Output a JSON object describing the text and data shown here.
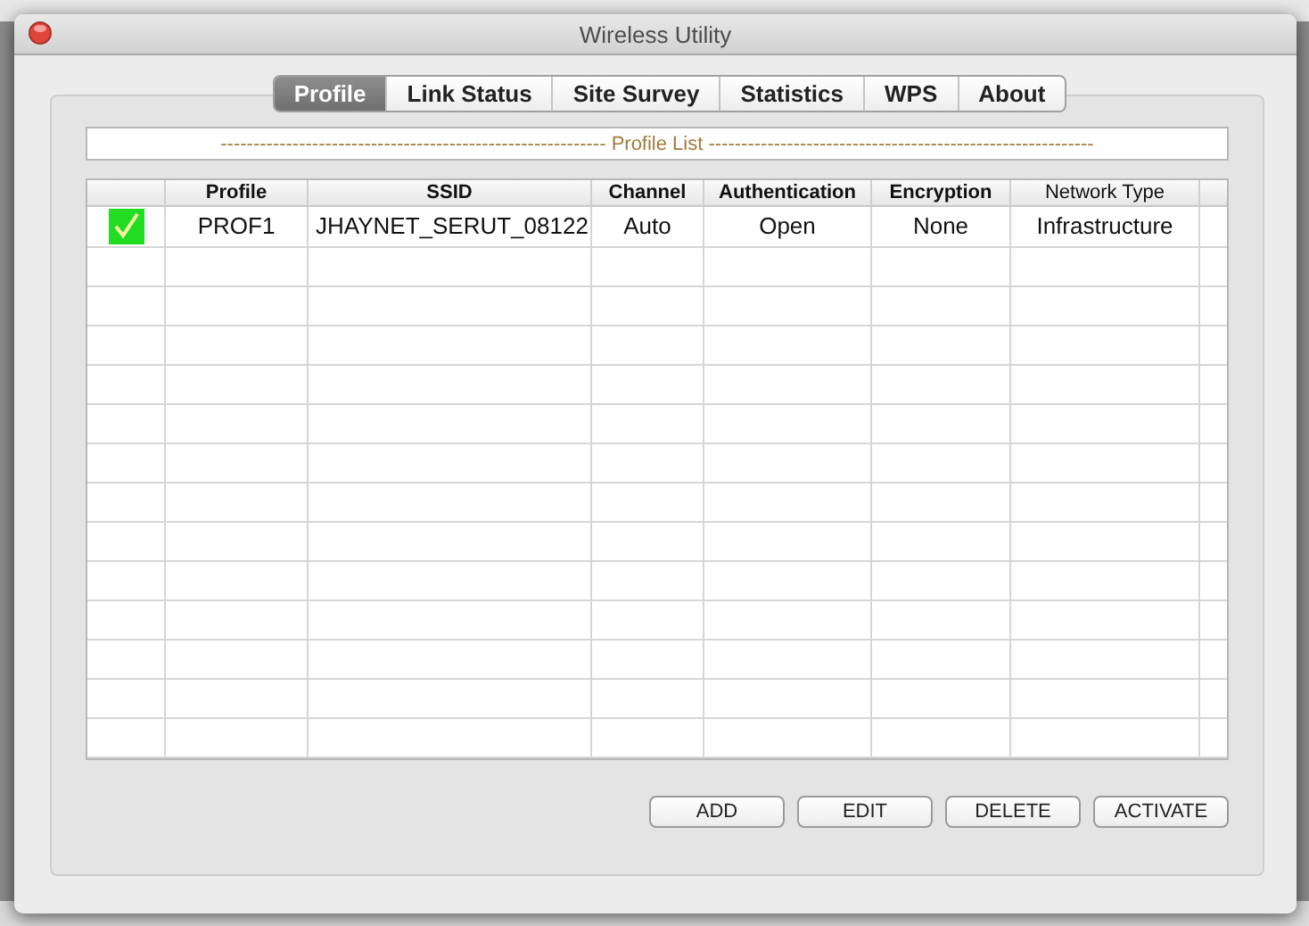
{
  "window": {
    "title": "Wireless Utility"
  },
  "tabs": [
    {
      "label": "Profile",
      "selected": true
    },
    {
      "label": "Link Status",
      "selected": false
    },
    {
      "label": "Site Survey",
      "selected": false
    },
    {
      "label": "Statistics",
      "selected": false
    },
    {
      "label": "WPS",
      "selected": false
    },
    {
      "label": "About",
      "selected": false
    }
  ],
  "profile_list": {
    "title": "----------------------------------------------------------- Profile List -----------------------------------------------------------"
  },
  "table": {
    "columns": [
      "Profile",
      "SSID",
      "Channel",
      "Authentication",
      "Encryption",
      "Network Type"
    ],
    "rows": [
      {
        "active": true,
        "cells": [
          "PROF1",
          "JHAYNET_SERUT_08122",
          "Auto",
          "Open",
          "None",
          "Infrastructure"
        ]
      }
    ]
  },
  "buttons": [
    "ADD",
    "EDIT",
    "DELETE",
    "ACTIVATE"
  ]
}
